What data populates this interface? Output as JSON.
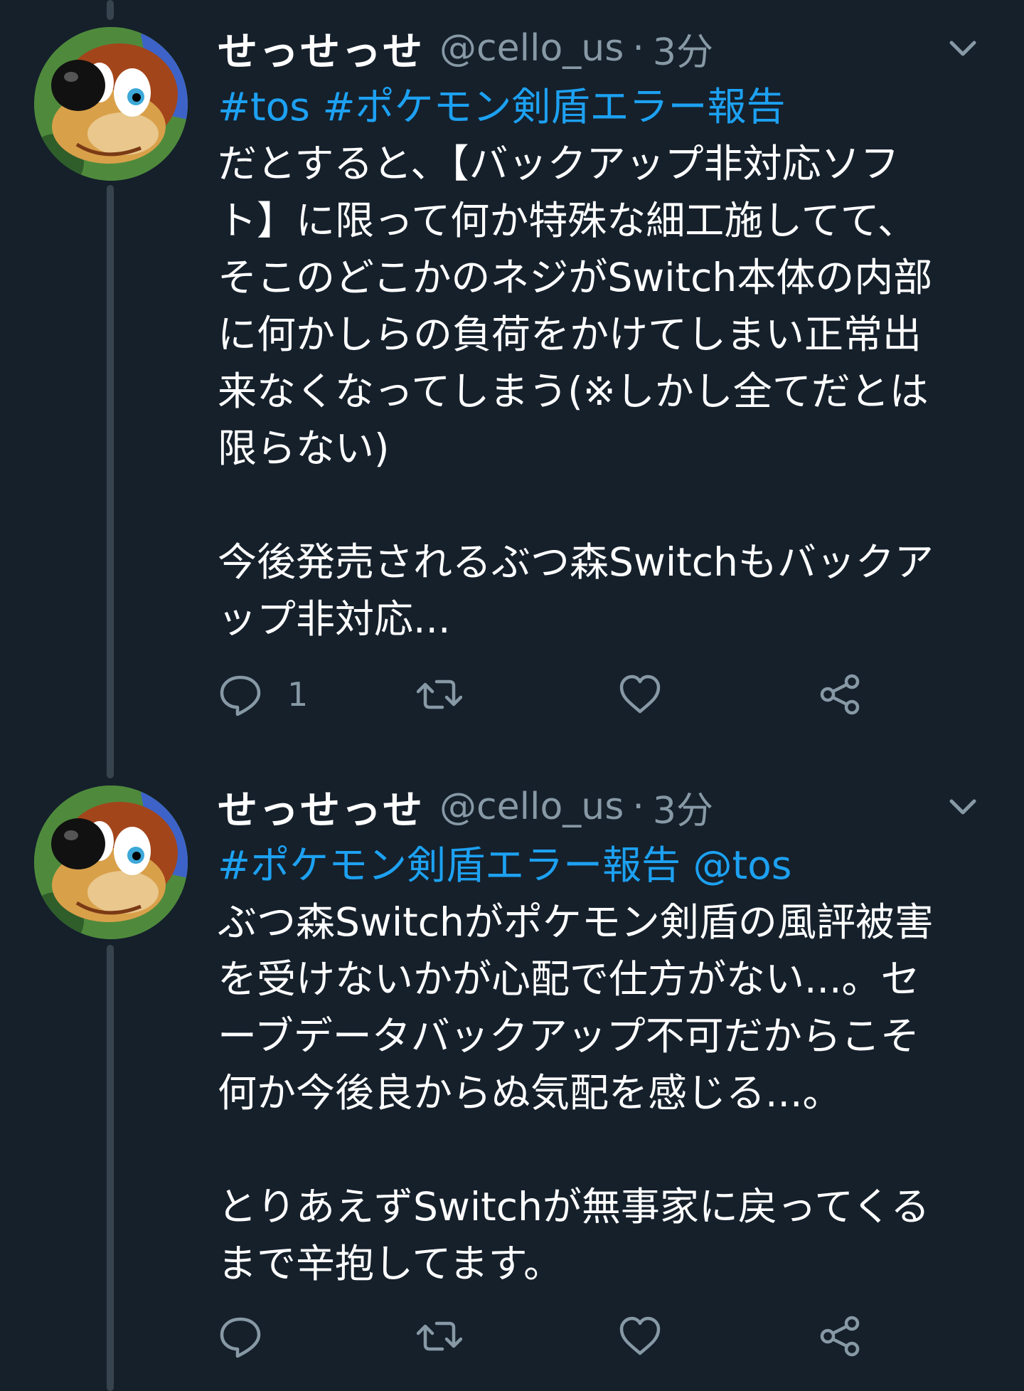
{
  "tweets": [
    {
      "display_name": "せっせっせ",
      "handle": "@cello_us",
      "separator": "·",
      "timestamp": "3分",
      "tags_line": [
        "#tos",
        " ",
        "#ポケモン剣盾エラー報告"
      ],
      "body_lines": [
        "だとすると、【バックアップ非対応ソフ",
        "ト】に限って何か特殊な細工施してて、",
        "そこのどこかのネジがSwitch本体の内部",
        "に何かしらの負荷をかけてしまい正常出",
        "来なくなってしまう(※しかし全てだとは",
        "限らない)",
        "",
        "今後発売されるぶつ森Switchもバックア",
        "ップ非対応..."
      ],
      "reply_count": "1",
      "icons": [
        "reply-icon",
        "retweet-icon",
        "like-icon",
        "share-icon",
        "chevron-down-icon"
      ]
    },
    {
      "display_name": "せっせっせ",
      "handle": "@cello_us",
      "separator": "·",
      "timestamp": "3分",
      "tags_line": [
        "#ポケモン剣盾エラー報告",
        " ",
        "@tos"
      ],
      "body_lines": [
        "ぶつ森Switchがポケモン剣盾の風評被害",
        "を受けないかが心配で仕方がない...。セ",
        "ーブデータバックアップ不可だからこそ",
        "何か今後良からぬ気配を感じる...。",
        "",
        "とりあえずSwitchが無事家に戻ってくる",
        "まで辛抱してます。"
      ],
      "reply_count": "",
      "icons": [
        "reply-icon",
        "retweet-icon",
        "like-icon",
        "share-icon",
        "chevron-down-icon"
      ]
    }
  ],
  "colors": {
    "background": "#15202b",
    "thread_line": "#38444d",
    "text": "#ffffff",
    "muted": "#8899a6",
    "link": "#1da1f2"
  }
}
